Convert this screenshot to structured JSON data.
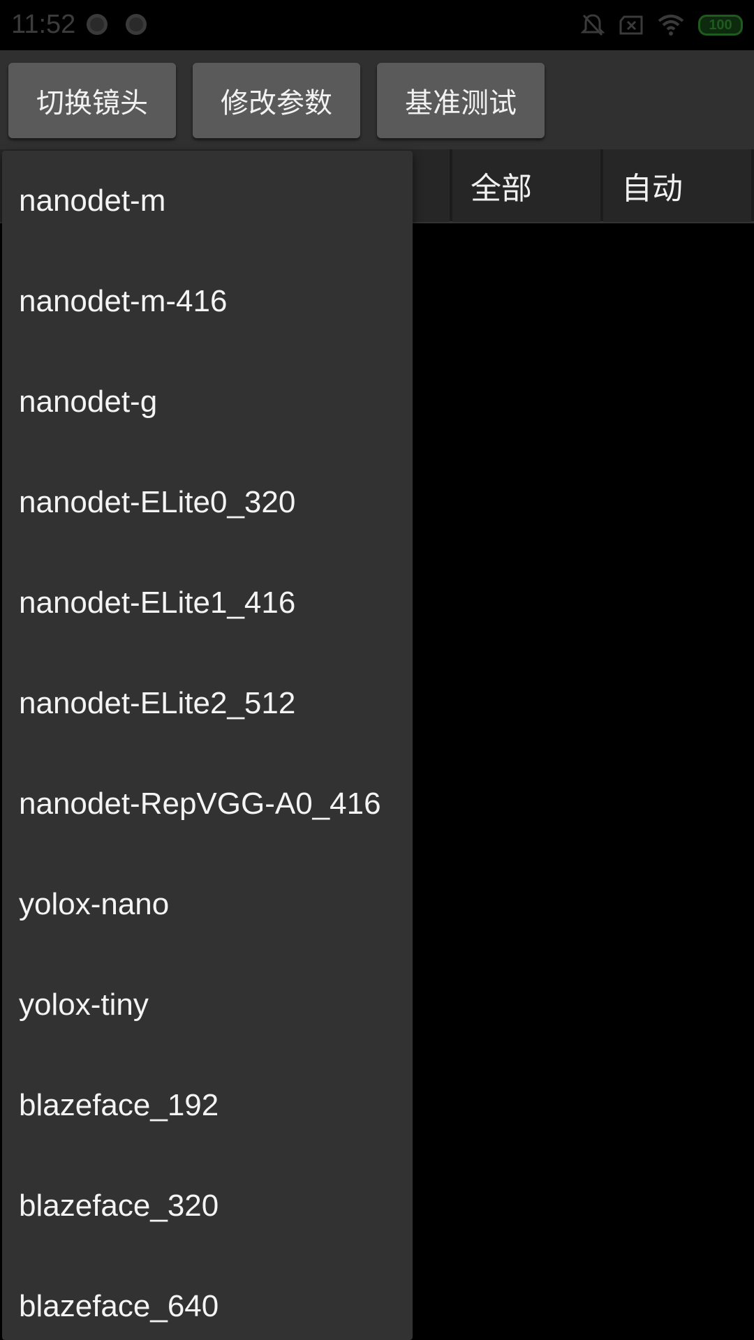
{
  "status_bar": {
    "time": "11:52",
    "battery": "100",
    "icons": [
      "notification-dot-icon",
      "notification-dot-icon",
      "mute-bell-icon",
      "no-sim-icon",
      "wifi-icon",
      "battery-icon"
    ]
  },
  "toolbar": {
    "buttons": [
      {
        "label": "切换镜头"
      },
      {
        "label": "修改参数"
      },
      {
        "label": "基准测试"
      }
    ]
  },
  "tabs": {
    "cells": [
      {
        "label": "全部"
      },
      {
        "label": "自动"
      }
    ]
  },
  "model_dropdown": {
    "items": [
      {
        "label": "nanodet-m"
      },
      {
        "label": "nanodet-m-416"
      },
      {
        "label": "nanodet-g"
      },
      {
        "label": "nanodet-ELite0_320"
      },
      {
        "label": "nanodet-ELite1_416"
      },
      {
        "label": "nanodet-ELite2_512"
      },
      {
        "label": "nanodet-RepVGG-A0_416"
      },
      {
        "label": "yolox-nano"
      },
      {
        "label": "yolox-tiny"
      },
      {
        "label": "blazeface_192"
      },
      {
        "label": "blazeface_320"
      },
      {
        "label": "blazeface_640"
      }
    ]
  },
  "colors": {
    "background": "#000000",
    "toolbar": "#303030",
    "button": "#5a5a5a",
    "dropdown": "#323232",
    "battery": "#1f5a1f"
  }
}
